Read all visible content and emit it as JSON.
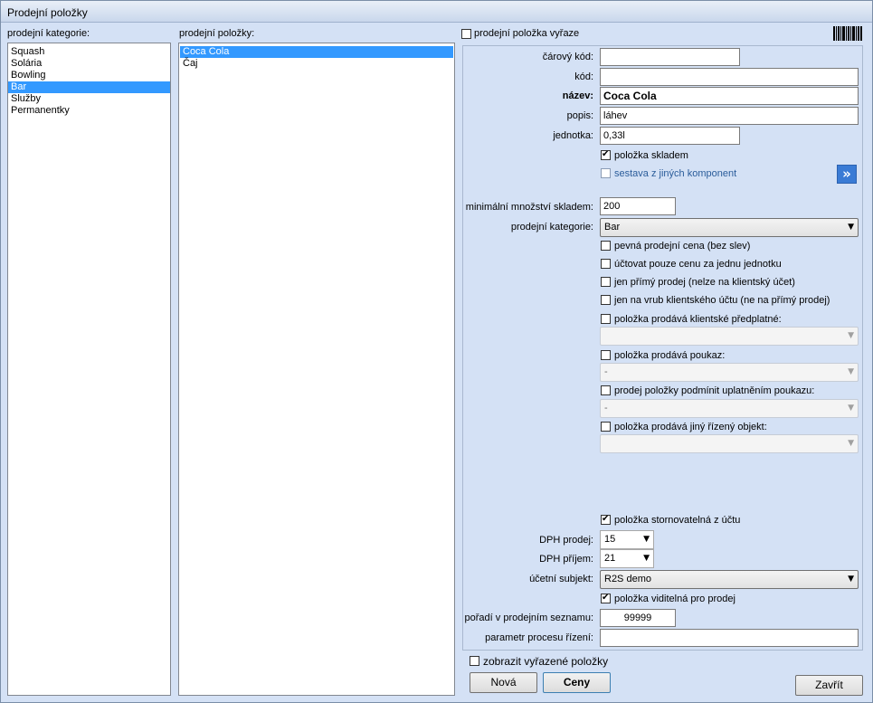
{
  "window": {
    "title": "Prodejní položky"
  },
  "categories": {
    "label": "prodejní kategorie:",
    "items": [
      "Squash",
      "Solária",
      "Bowling",
      "Bar",
      "Služby",
      "Permanentky"
    ],
    "selected": 3
  },
  "items": {
    "label": "prodejní položky:",
    "items": [
      "Coca Cola",
      "Čaj"
    ],
    "selected": 0
  },
  "detail": {
    "retired_label": "prodejní položka vyřaze",
    "barcode_label": "čárový kód:",
    "barcode_value": "",
    "code_label": "kód:",
    "code_value": "",
    "name_label": "název:",
    "name_value": "Coca Cola",
    "desc_label": "popis:",
    "desc_value": "láhev",
    "unit_label": "jednotka:",
    "unit_value": "0,33l",
    "stock_label": "položka skladem",
    "stock_checked": true,
    "assembly_label": "sestava z jiných komponent",
    "assembly_checked": false,
    "expand_icon": "double-chevron-right-icon",
    "minstock_label": "minimální množství skladem:",
    "minstock_value": "200",
    "category_label": "prodejní kategorie:",
    "category_value": "Bar",
    "fixed_price_label": "pevná prodejní cena (bez slev)",
    "unit_price_label": "účtovat pouze cenu za jednu jednotku",
    "direct_label": "jen přímý prodej (nelze na klientský účet)",
    "client_label": "jen na vrub klientského účtu (ne na přímý prodej)",
    "subscription_label": "položka prodává klientské předplatné:",
    "subscription_value": "",
    "voucher_label": "položka prodává poukaz:",
    "voucher_value": "-",
    "voucher_cond_label": "prodej položky podmínit uplatněním poukazu:",
    "voucher_cond_value": "-",
    "other_obj_label": "položka prodává jiný řízený objekt:",
    "other_obj_value": "",
    "cancelable_label": "položka stornovatelná z účtu",
    "cancelable_checked": true,
    "vat_sale_label": "DPH prodej:",
    "vat_sale_value": "15",
    "vat_purchase_label": "DPH příjem:",
    "vat_purchase_value": "21",
    "entity_label": "účetní subjekt:",
    "entity_value": "R2S demo",
    "visible_label": "položka viditelná pro prodej",
    "visible_checked": true,
    "order_label": "pořadí v prodejním seznamu:",
    "order_value": "99999",
    "param_label": "parametr procesu řízení:",
    "param_value": ""
  },
  "footer": {
    "show_retired_label": "zobrazit vyřazené položky",
    "new_label": "Nová",
    "prices_label": "Ceny",
    "close_label": "Zavřít"
  },
  "icons": {
    "barcode": "barcode-icon",
    "dropdown": "chevron-down-icon"
  }
}
